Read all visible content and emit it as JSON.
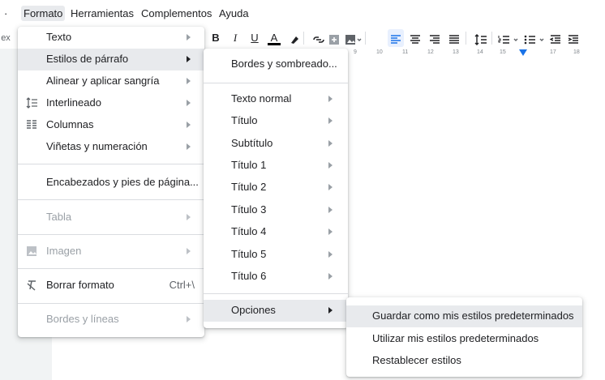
{
  "menubar": {
    "prefix": "·",
    "items": [
      "Formato",
      "Herramientas",
      "Complementos",
      "Ayuda"
    ]
  },
  "toolbar": {
    "cut_label": "ex",
    "bold": "B",
    "italic": "I",
    "underline": "U",
    "text_color": "A"
  },
  "ruler": {
    "ticks": [
      "9",
      "10",
      "11",
      "12",
      "13",
      "14",
      "15",
      "17",
      "18"
    ]
  },
  "format_menu": {
    "items": [
      {
        "label": "Texto"
      },
      {
        "label": "Estilos de párrafo"
      },
      {
        "label": "Alinear y aplicar sangría"
      },
      {
        "label": "Interlineado"
      },
      {
        "label": "Columnas"
      },
      {
        "label": "Viñetas y numeración"
      },
      {
        "label": "Encabezados y pies de página..."
      },
      {
        "label": "Tabla"
      },
      {
        "label": "Imagen"
      },
      {
        "label": "Borrar formato",
        "shortcut": "Ctrl+\\"
      },
      {
        "label": "Bordes y líneas"
      }
    ]
  },
  "paragraph_styles_menu": {
    "items": [
      {
        "label": "Bordes y sombreado..."
      },
      {
        "label": "Texto normal"
      },
      {
        "label": "Título"
      },
      {
        "label": "Subtítulo"
      },
      {
        "label": "Título 1"
      },
      {
        "label": "Título 2"
      },
      {
        "label": "Título 3"
      },
      {
        "label": "Título 4"
      },
      {
        "label": "Título 5"
      },
      {
        "label": "Título 6"
      },
      {
        "label": "Opciones"
      }
    ]
  },
  "options_menu": {
    "items": [
      {
        "label": "Guardar como mis estilos predeterminados"
      },
      {
        "label": "Utilizar mis estilos predeterminados"
      },
      {
        "label": "Restablecer estilos"
      }
    ]
  },
  "colors": {
    "accent": "#1a73e8",
    "highlight": "#e8eaed",
    "disabled": "#9aa0a6"
  }
}
